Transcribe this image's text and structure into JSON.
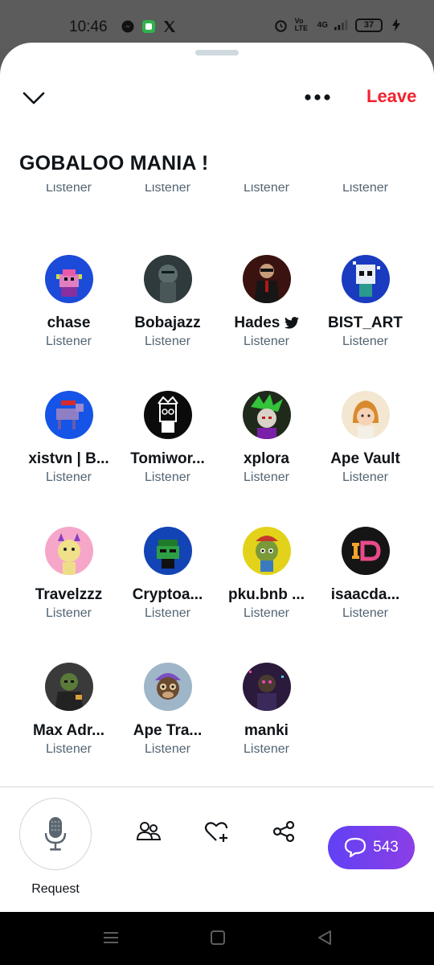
{
  "status_bar": {
    "time": "10:46",
    "left_icons": [
      "messenger-icon",
      "app-notification-icon",
      "x-logo-icon"
    ],
    "right_icons": [
      "alarm-icon",
      "volte-icon",
      "4g-signal-icon",
      "signal-icon"
    ],
    "volte_label": "Vo LTE",
    "network_label": "4G",
    "battery": "37"
  },
  "space": {
    "title": "GOBALOO MANIA !",
    "leave_label": "Leave"
  },
  "listeners": [
    {
      "name": "",
      "role": "Listener"
    },
    {
      "name": "",
      "role": "Listener"
    },
    {
      "name": "",
      "role": "Listener"
    },
    {
      "name": "",
      "role": "Listener"
    },
    {
      "name": "chase",
      "role": "Listener",
      "avatar_color": "#1b4bd8"
    },
    {
      "name": "Bobajazz",
      "role": "Listener",
      "avatar_color": "#3e4a4d"
    },
    {
      "name": "Hades",
      "role": "Listener",
      "avatar_color": "#3a1310",
      "verified_icon": "bird-icon"
    },
    {
      "name": "BIST_ART",
      "role": "Listener",
      "avatar_color": "#1a3bc0"
    },
    {
      "name": "xistvn | B...",
      "role": "Listener",
      "avatar_color": "#1554e6"
    },
    {
      "name": "Tomiwor...",
      "role": "Listener",
      "avatar_color": "#0b0b0b"
    },
    {
      "name": "xplora",
      "role": "Listener",
      "avatar_color": "#1f2a1c"
    },
    {
      "name": "Ape Vault",
      "role": "Listener",
      "avatar_color": "#f3e7d2"
    },
    {
      "name": "Travelzzz",
      "role": "Listener",
      "avatar_color": "#f6a7c9"
    },
    {
      "name": "Cryptoa...",
      "role": "Listener",
      "avatar_color": "#1344b5"
    },
    {
      "name": "pku.bnb ...",
      "role": "Listener",
      "avatar_color": "#e2d31a"
    },
    {
      "name": "isaacda...",
      "role": "Listener",
      "avatar_color": "#151515"
    },
    {
      "name": "Max Adr...",
      "role": "Listener",
      "avatar_color": "#3a3a3a"
    },
    {
      "name": "Ape Tra...",
      "role": "Listener",
      "avatar_color": "#6b5da0"
    },
    {
      "name": "manki",
      "role": "Listener",
      "avatar_color": "#2b1a3b"
    }
  ],
  "bottom": {
    "request_label": "Request",
    "chat_count": "543"
  },
  "colors": {
    "leave": "#f4212e",
    "chat_gradient_start": "#6140f5",
    "chat_gradient_end": "#8b3fe6",
    "secondary_text": "#536471"
  }
}
